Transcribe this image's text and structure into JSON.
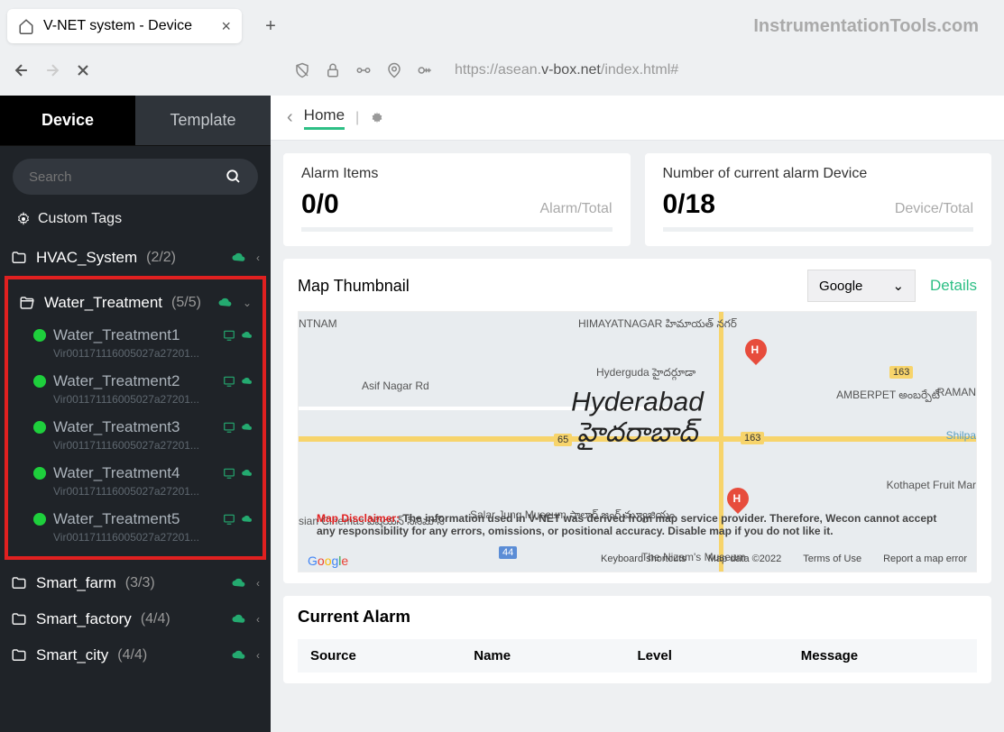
{
  "browser": {
    "tab_title": "V-NET system - Device",
    "watermark": "InstrumentationTools.com",
    "url_prefix": "https://asean.",
    "url_strong": "v-box.net",
    "url_suffix": "/index.html#"
  },
  "sidebar": {
    "tab_device": "Device",
    "tab_template": "Template",
    "search_placeholder": "Search",
    "custom_tags": "Custom Tags",
    "items": [
      {
        "name": "HVAC_System",
        "count": "(2/2)"
      },
      {
        "name": "Water_Treatment",
        "count": "(5/5)"
      },
      {
        "name": "Smart_farm",
        "count": "(3/3)"
      },
      {
        "name": "Smart_factory",
        "count": "(4/4)"
      },
      {
        "name": "Smart_city",
        "count": "(4/4)"
      }
    ],
    "subitems": [
      {
        "label": "Water_Treatment1",
        "sn": "Vir001171116005027a27201..."
      },
      {
        "label": "Water_Treatment2",
        "sn": "Vir001171116005027a27201..."
      },
      {
        "label": "Water_Treatment3",
        "sn": "Vir001171116005027a27201..."
      },
      {
        "label": "Water_Treatment4",
        "sn": "Vir001171116005027a27201..."
      },
      {
        "label": "Water_Treatment5",
        "sn": "Vir001171116005027a27201..."
      }
    ]
  },
  "breadcrumb": {
    "home": "Home"
  },
  "cards": {
    "alarm_title": "Alarm Items",
    "alarm_value": "0/0",
    "alarm_sub": "Alarm/Total",
    "device_title": "Number of current alarm Device",
    "device_value": "0/18",
    "device_sub": "Device/Total"
  },
  "map": {
    "title": "Map Thumbnail",
    "provider": "Google",
    "details": "Details",
    "place_main": "Hyderabad",
    "place_sub": "హైదరాబాద్",
    "areas": {
      "himayat": "HIMAYATNAGAR హిమాయత్ నగర్",
      "hyderguda": "Hyderguda హైదర్గూడా",
      "asif": "Asif Nagar Rd",
      "amberpet": "AMBERPET అంబర్పేట్",
      "raman": "RAMAN",
      "shilpa": "Shilpa",
      "kothapet": "Kothapet Fruit Mar",
      "salar": "Salar Jung Museum సాలార్ జంగ్ మ్యూజియం",
      "nizam": "The Nizam's Museum",
      "ntnam": "NTNAM",
      "cinemas": "sian Cinemas ఏషియన్ సినిమాస్"
    },
    "road_labels": {
      "r163a": "163",
      "r163b": "163",
      "r65": "65",
      "r44": "44"
    },
    "disclaimer_label": "Map Disclaimer:",
    "disclaimer_text": "The information used in V-NET was derived from map service provider. Therefore, Wecon cannot accept any responsibility for any errors, omissions, or positional accuracy. Disable map if you do not like it.",
    "footer": {
      "shortcuts": "Keyboard shortcuts",
      "mapdata": "Map data ©2022",
      "terms": "Terms of Use",
      "report": "Report a map error"
    }
  },
  "alarm": {
    "title": "Current Alarm",
    "h_source": "Source",
    "h_name": "Name",
    "h_level": "Level",
    "h_message": "Message"
  }
}
